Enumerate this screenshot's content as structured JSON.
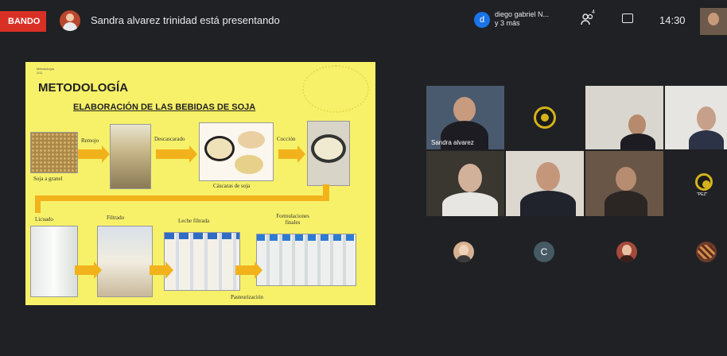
{
  "topbar": {
    "recording_label": "BANDO",
    "presenting_text": "Sandra alvarez trinidad está presentando",
    "participant_initial": "d",
    "participant_name": "diego gabriel N...",
    "participant_more": "y 3 más",
    "people_count": "4",
    "clock": "14:30"
  },
  "slide": {
    "small_header": "Metodología\n2/11",
    "title": "METODOLOGÍA",
    "subtitle": "ELABORACIÓN DE LAS BEBIDAS DE SOJA",
    "labels": {
      "soja": "Soja a granel",
      "remojo": "Remojo",
      "descascarado": "Descascarado",
      "coccion": "Cocción",
      "cascaras": "Cáscaras de soja",
      "licuado": "Licuado",
      "filtrado": "Filtrado",
      "leche": "Leche filtrada",
      "formulaciones": "Formulaciones finales",
      "pasteurizacion": "Pasteurización"
    }
  },
  "grid": {
    "sandra_name": "Sandra alvarez",
    "logo_label": "\"PEZ\"",
    "avatar_c": "C"
  },
  "colors": {
    "background": "#202124",
    "slide_yellow": "#f7f169",
    "arrow_orange": "#f2b21c",
    "recording_red": "#d93025",
    "badge_blue": "#1a73e8"
  }
}
